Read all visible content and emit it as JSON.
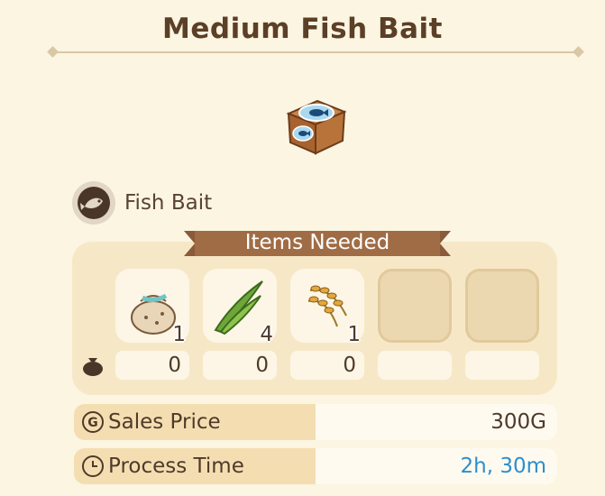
{
  "item": {
    "title": "Medium Fish Bait",
    "icon": "fish-bait-box-icon"
  },
  "category": {
    "label": "Fish Bait",
    "icon": "fish-category-icon"
  },
  "items_needed": {
    "header": "Items Needed",
    "slots": [
      {
        "icon": "seed-bag-icon",
        "required": "1",
        "owned": "0"
      },
      {
        "icon": "grass-blades-icon",
        "required": "4",
        "owned": "0"
      },
      {
        "icon": "rice-stalk-icon",
        "required": "1",
        "owned": "0"
      },
      {
        "icon": "empty-slot",
        "required": "",
        "owned": ""
      },
      {
        "icon": "empty-slot",
        "required": "",
        "owned": ""
      }
    ],
    "owned_icon": "bag-icon"
  },
  "sales_price": {
    "label": "Sales Price",
    "value": "300G",
    "icon": "gold-coin-icon"
  },
  "process_time": {
    "label": "Process Time",
    "value": "2h, 30m",
    "icon": "clock-icon"
  }
}
